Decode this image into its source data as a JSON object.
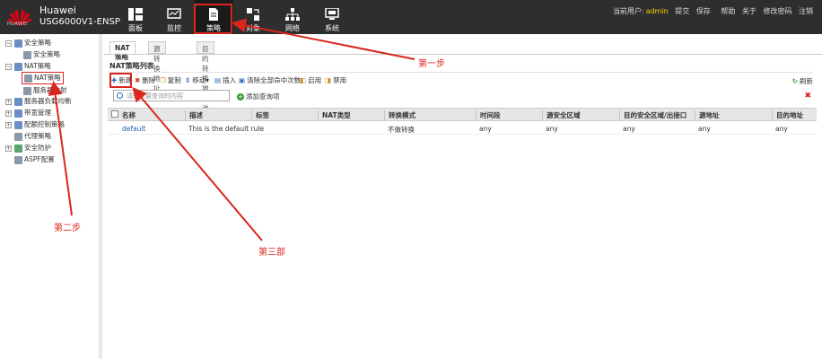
{
  "header": {
    "brand": "Huawei",
    "model": "USG6000V1-ENSP",
    "logo_text": "HUAWEI",
    "nav": [
      {
        "label": "面板",
        "icon": "dashboard-icon"
      },
      {
        "label": "监控",
        "icon": "monitor-icon"
      },
      {
        "label": "策略",
        "icon": "policy-document-icon"
      },
      {
        "label": "对象",
        "icon": "object-icon"
      },
      {
        "label": "网络",
        "icon": "network-icon"
      },
      {
        "label": "系统",
        "icon": "system-icon"
      }
    ],
    "current_user_label": "当前用户:",
    "current_user": "admin",
    "links": [
      "提交",
      "保存",
      "帮助",
      "关于",
      "修改密码",
      "注销"
    ]
  },
  "sidebar": {
    "items": [
      {
        "label": "安全策略",
        "level": 0,
        "expander": "−"
      },
      {
        "label": "安全策略",
        "level": 1
      },
      {
        "label": "NAT策略",
        "level": 0,
        "expander": "−"
      },
      {
        "label": "NAT策略",
        "level": 1
      },
      {
        "label": "服务器映射",
        "level": 1
      },
      {
        "label": "服务器负载均衡",
        "level": 0,
        "expander": "+"
      },
      {
        "label": "带宽管理",
        "level": 0,
        "expander": "+"
      },
      {
        "label": "配额控制策略",
        "level": 0,
        "expander": "+"
      },
      {
        "label": "代理策略",
        "level": 0
      },
      {
        "label": "安全防护",
        "level": 0,
        "expander": "+"
      },
      {
        "label": "ASPF配置",
        "level": 0
      }
    ]
  },
  "main": {
    "tabs": [
      "NAT策略",
      "源转换地址池",
      "目的转换地址池"
    ],
    "section_title": "NAT策略列表",
    "toolbar": [
      "新建",
      "删除",
      "复制",
      "移动▾",
      "插入",
      "清除全部命中次数",
      "启用",
      "禁用"
    ],
    "refresh": "刷新",
    "search_placeholder": "请输入要查询的内容",
    "advanced_search": "添加查询项",
    "columns": [
      "名称",
      "描述",
      "标签",
      "NAT类型",
      "转换模式",
      "时间段",
      "源安全区域",
      "目的安全区域/出接口",
      "源地址",
      "目的地址"
    ],
    "rows": [
      [
        "default",
        "This is the default rule",
        "",
        "",
        "不做转换",
        "any",
        "any",
        "any",
        "any",
        "any"
      ]
    ]
  },
  "annotations": {
    "step1": "第一步",
    "step2": "第二步",
    "step3": "第三部"
  },
  "colors": {
    "header_bg": "#2e2e2e",
    "annotation_red": "#d9271e",
    "link_blue": "#1a5fb4",
    "user_yellow": "#f2d300"
  }
}
